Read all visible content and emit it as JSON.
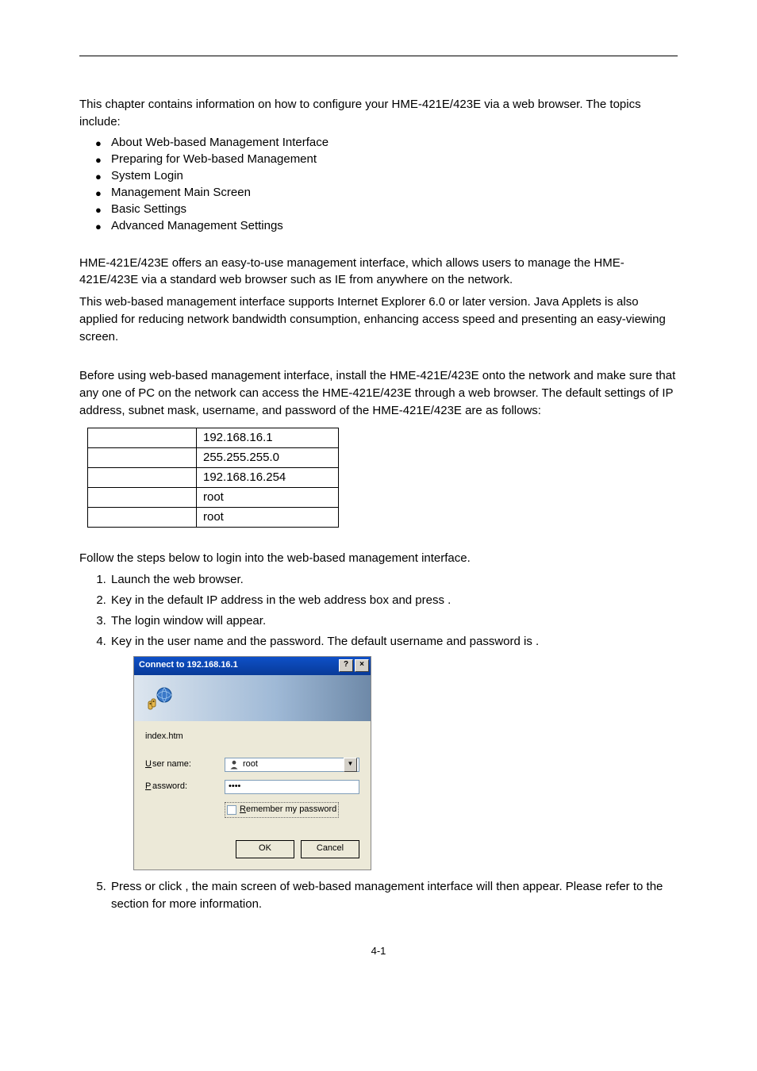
{
  "intro": "This chapter contains information on how to configure your HME-421E/423E via a web browser. The topics include:",
  "topics": [
    "About Web-based Management Interface",
    "Preparing for Web-based Management",
    "System Login",
    "Management Main Screen",
    "Basic Settings",
    "Advanced Management Settings"
  ],
  "about": {
    "p1": "HME-421E/423E offers an easy-to-use management interface, which allows users to manage the HME-421E/423E via a standard web browser such as IE from anywhere on the network.",
    "p2": "This web-based management interface supports Internet Explorer 6.0 or later version. Java Applets is also applied for reducing network bandwidth consumption, enhancing access speed and presenting an easy-viewing screen."
  },
  "prep": {
    "p1": "Before using web-based management interface, install the HME-421E/423E onto the network and make sure that any one of PC on the network can access the HME-421E/423E through a web browser. The default settings of IP address, subnet mask, username, and password of the HME-421E/423E are as follows:"
  },
  "table": [
    {
      "label": "",
      "value": "192.168.16.1"
    },
    {
      "label": "",
      "value": "255.255.255.0"
    },
    {
      "label": "",
      "value": "192.168.16.254"
    },
    {
      "label": "",
      "value": "root"
    },
    {
      "label": "",
      "value": "root"
    }
  ],
  "login_intro": "Follow the steps below to login into the web-based management interface.",
  "steps": {
    "s1": "Launch the web browser.",
    "s2a": "Key in the default IP address in the web address box and press ",
    "s2b": ".",
    "s3": "The login window will appear.",
    "s4a": "Key in the user name and the password. The default username and password is ",
    "s4b": ".",
    "s5a": "Press ",
    "s5b": " or click ",
    "s5c": ", the main screen of web-based management interface will then appear. Please refer to the ",
    "s5d": " section for more information."
  },
  "dialog": {
    "title": "Connect to 192.168.16.1",
    "resource": "index.htm",
    "user_label": "ser name:",
    "user_letter": "U",
    "pass_label": "assword:",
    "pass_letter": "P",
    "user_value": "root",
    "pass_value": "••••",
    "remember_letter": "R",
    "remember": "emember my password",
    "ok": "OK",
    "cancel": "Cancel"
  },
  "pagenum": "4-1"
}
